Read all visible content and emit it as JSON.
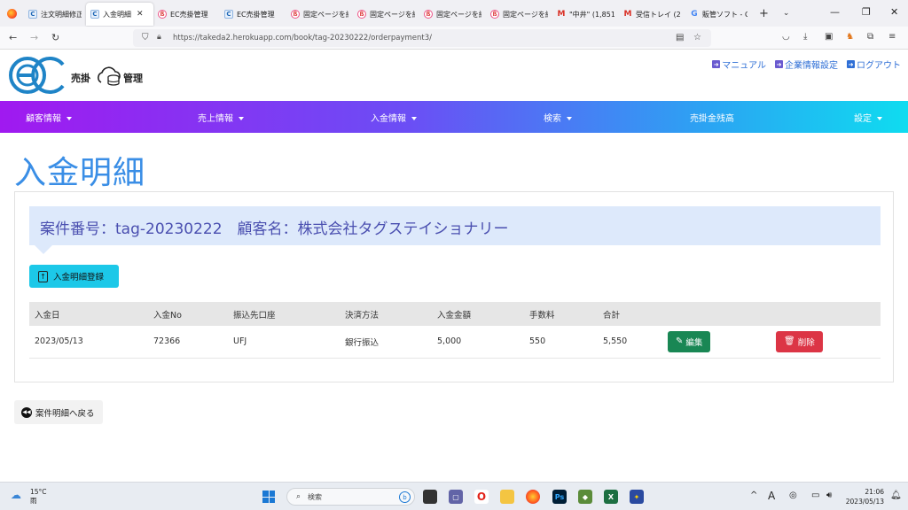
{
  "browser": {
    "tabs": [
      {
        "label": "注文明細修正",
        "icon": "ec"
      },
      {
        "label": "入金明細",
        "icon": "ec",
        "active": true
      },
      {
        "label": "EC売掛管理",
        "icon": "pp"
      },
      {
        "label": "EC売掛管理",
        "icon": "ec"
      },
      {
        "label": "固定ページを編",
        "icon": "pp"
      },
      {
        "label": "固定ページを編",
        "icon": "pp"
      },
      {
        "label": "固定ページを編",
        "icon": "pp"
      },
      {
        "label": "固定ページを編",
        "icon": "pp"
      },
      {
        "label": "\"中井\" (1,851",
        "icon": "gm"
      },
      {
        "label": "受信トレイ (26",
        "icon": "gm"
      },
      {
        "label": "販管ソフト - G",
        "icon": "gg"
      }
    ],
    "url": "https://takeda2.herokuapp.com/book/tag-20230222/orderpayment3/"
  },
  "header": {
    "logo_text": "売掛",
    "logo_text2": "管理",
    "links": [
      {
        "label": "マニュアル"
      },
      {
        "label": "企業情報設定"
      },
      {
        "label": "ログアウト"
      }
    ]
  },
  "menu": {
    "items": [
      {
        "label": "顧客情報",
        "dropdown": true
      },
      {
        "label": "売上情報",
        "dropdown": true
      },
      {
        "label": "入金情報",
        "dropdown": true
      },
      {
        "label": "検索",
        "dropdown": true
      },
      {
        "label": "売掛金残高",
        "dropdown": false
      },
      {
        "label": "設定",
        "dropdown": true
      }
    ],
    "gradient": [
      "#a019f0",
      "#6b4ef5",
      "#2ba4f3",
      "#0fdcf0"
    ]
  },
  "page": {
    "title": "入金明細",
    "banner": "案件番号：tag-20230222　顧客名：株式会社タグステイショナリー",
    "register_button": "入金明細登録",
    "table": {
      "headers": [
        "入金日",
        "入金No",
        "振込先口座",
        "決済方法",
        "入金金額",
        "手数料",
        "合計",
        "",
        ""
      ],
      "rows": [
        {
          "date": "2023/05/13",
          "no": "72366",
          "account": "UFJ",
          "method": "銀行振込",
          "amount": "5,000",
          "fee": "550",
          "total": "5,550"
        }
      ],
      "edit_label": "編集",
      "delete_label": "削除"
    },
    "back_button": "案件明細へ戻る"
  },
  "taskbar": {
    "weather_temp": "15°C",
    "weather_desc": "雨",
    "search_placeholder": "検索",
    "ime": "A",
    "time": "21:06",
    "date": "2023/05/13"
  },
  "colors": {
    "title": "#3a8ee6",
    "banner_bg": "#dde9fb",
    "banner_text": "#4a4fb0",
    "register": "#1cc8e8",
    "edit": "#198754",
    "delete": "#dc3545"
  }
}
